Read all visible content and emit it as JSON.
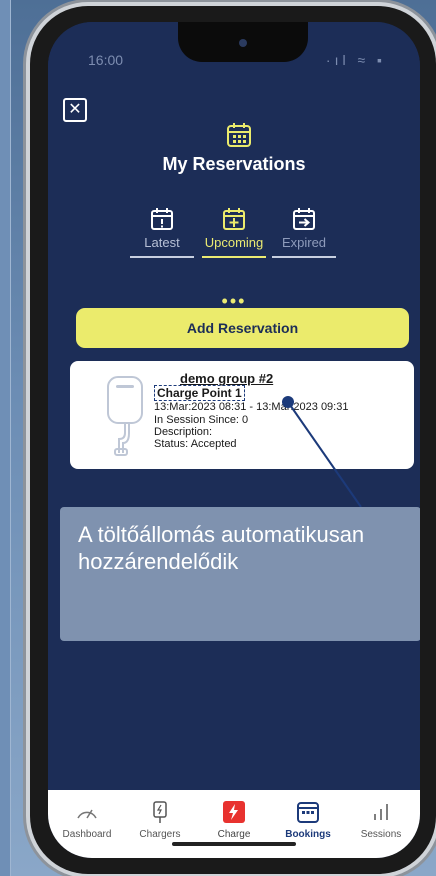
{
  "status_bar": {
    "time": "16:00",
    "icons": "·ıl ≈ ▪"
  },
  "header": {
    "title": "My Reservations"
  },
  "tabs": [
    {
      "label": "Latest"
    },
    {
      "label": "Upcoming"
    },
    {
      "label": "Expired"
    }
  ],
  "dots": "•••",
  "add_button_label": "Add Reservation",
  "reservation": {
    "group": "demo group #2",
    "charge_point": "Charge Point 1",
    "time_range": "13:Mar:2023 08:31 - 13:Mar:2023 09:31",
    "session": "In Session Since: 0",
    "description": "Description:",
    "status": "Status: Accepted"
  },
  "callout": "A töltőállomás automatikusan hozzárendelődik",
  "nav": [
    {
      "label": "Dashboard",
      "icon": "speedometer-icon"
    },
    {
      "label": "Chargers",
      "icon": "charger-icon"
    },
    {
      "label": "Charge",
      "icon": "lightning-icon"
    },
    {
      "label": "Bookings",
      "icon": "calendar-icon",
      "active": true
    },
    {
      "label": "Sessions",
      "icon": "bar-chart-icon"
    }
  ],
  "colors": {
    "bg": "#1c2d57",
    "accent": "#ebeb6c",
    "charge_red": "#e8322f"
  }
}
